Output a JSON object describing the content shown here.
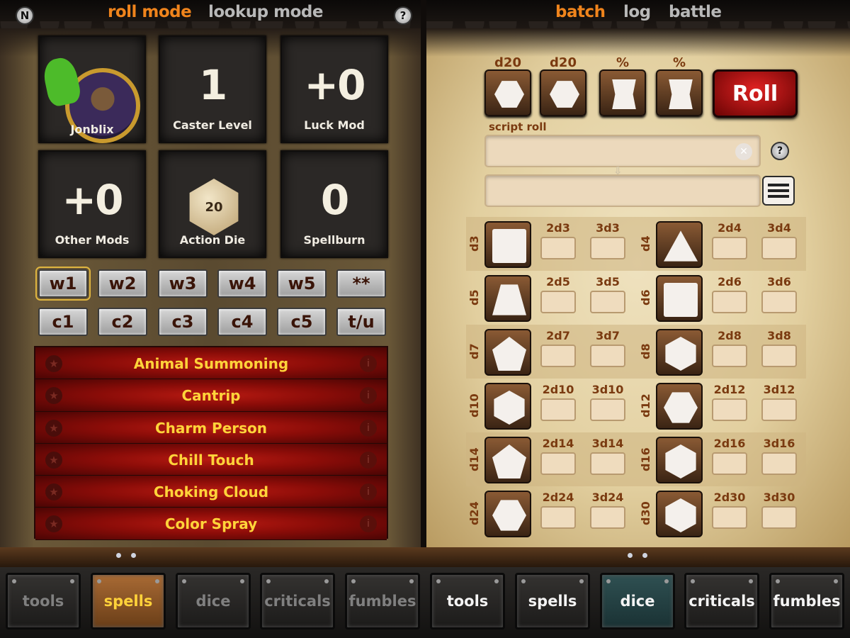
{
  "top": {
    "left_btn": "N",
    "help_btn": "?",
    "mode_tabs": [
      {
        "label": "roll mode",
        "active": true
      },
      {
        "label": "lookup mode",
        "active": false
      }
    ],
    "right_tabs": [
      {
        "label": "batch",
        "active": true
      },
      {
        "label": "log",
        "active": false
      },
      {
        "label": "battle",
        "active": false
      }
    ]
  },
  "stats": {
    "character": {
      "name": "Jonblix"
    },
    "caster_level": {
      "value": "1",
      "label": "Caster Level"
    },
    "luck_mod": {
      "value": "+0",
      "label": "Luck Mod"
    },
    "other_mods": {
      "value": "+0",
      "label": "Other Mods"
    },
    "action_die": {
      "value": "20",
      "label": "Action Die"
    },
    "spellburn": {
      "value": "0",
      "label": "Spellburn"
    }
  },
  "slot_buttons": {
    "row1": [
      "w1",
      "w2",
      "w3",
      "w4",
      "w5",
      "**"
    ],
    "row2": [
      "c1",
      "c2",
      "c3",
      "c4",
      "c5",
      "t/u"
    ],
    "selected": "w1"
  },
  "spells": {
    "star_icon": "★",
    "info_icon": "i",
    "items": [
      "Animal Summoning",
      "Cantrip",
      "Charm Person",
      "Chill Touch",
      "Choking Cloud",
      "Color Spray"
    ]
  },
  "dice_top": {
    "dice": [
      {
        "label": "d20",
        "shape": "hex"
      },
      {
        "label": "d20",
        "shape": "hex"
      },
      {
        "label": "%",
        "shape": "pct"
      },
      {
        "label": "%",
        "shape": "pct"
      }
    ],
    "roll_label": "Roll",
    "script_label": "script roll",
    "clear_icon": "✕",
    "help_icon": "?",
    "arrow_icon": "⇩"
  },
  "dice_grid": [
    [
      {
        "die": "d3",
        "shape": "sq",
        "m2": "2d3",
        "m3": "3d3"
      },
      {
        "die": "d4",
        "shape": "tri",
        "m2": "2d4",
        "m3": "3d4"
      }
    ],
    [
      {
        "die": "d5",
        "shape": "trap",
        "m2": "2d5",
        "m3": "3d5"
      },
      {
        "die": "d6",
        "shape": "sq",
        "m2": "2d6",
        "m3": "3d6"
      }
    ],
    [
      {
        "die": "d7",
        "shape": "pent",
        "m2": "2d7",
        "m3": "3d7"
      },
      {
        "die": "d8",
        "shape": "hexv",
        "m2": "2d8",
        "m3": "3d8"
      }
    ],
    [
      {
        "die": "d10",
        "shape": "hexv",
        "m2": "2d10",
        "m3": "3d10"
      },
      {
        "die": "d12",
        "shape": "hex",
        "m2": "2d12",
        "m3": "3d12"
      }
    ],
    [
      {
        "die": "d14",
        "shape": "pent",
        "m2": "2d14",
        "m3": "3d14"
      },
      {
        "die": "d16",
        "shape": "hexv",
        "m2": "2d16",
        "m3": "3d16"
      }
    ],
    [
      {
        "die": "d24",
        "shape": "hex",
        "m2": "2d24",
        "m3": "3d24"
      },
      {
        "die": "d30",
        "shape": "hexv",
        "m2": "2d30",
        "m3": "3d30"
      }
    ]
  ],
  "bottom_tabs": {
    "left": [
      "tools",
      "spells",
      "dice",
      "criticals",
      "fumbles"
    ],
    "right": [
      "tools",
      "spells",
      "dice",
      "criticals",
      "fumbles"
    ],
    "active_left": "spells",
    "active_right": "dice"
  },
  "colors": {
    "accent_orange": "#f0841c",
    "spell_text": "#ffd43a",
    "roll_red": "#c41414"
  }
}
